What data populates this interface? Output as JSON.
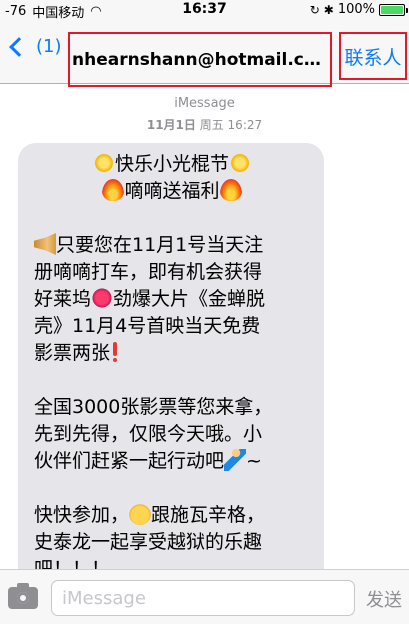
{
  "status_bar": {
    "signal": "-76",
    "carrier": "中国移动",
    "time": "16:37",
    "battery_percent": "100%",
    "battery_level": 1.0
  },
  "nav": {
    "back_label": "(1)",
    "recipient": "nhearnshann@hotmail.com",
    "contact_label": "联系人"
  },
  "conversation": {
    "service": "iMessage",
    "date": "11月1日",
    "weekday_time": "周五 16:27"
  },
  "message": {
    "title_line1": "快乐小光棍节",
    "title_line2": "嘀嘀送福利",
    "p1_l1": "只要您在11月1号当天注",
    "p1_l2": "册嘀嘀打车，即有机会获得",
    "p1_l3": "好莱坞",
    "p1_l3b": "劲爆大片《金蝉脱",
    "p1_l4": "壳》11月4号首映当天免费",
    "p1_l5": "影票两张",
    "p2_l1": "全国3000张影票等您来拿，",
    "p2_l2": "先到先得，仅限今天哦。小",
    "p2_l3": "伙伴们赶紧一起行动吧",
    "p2_l3b": "~",
    "p3_l1": "快快参加，",
    "p3_l1b": "跟施瓦辛格，",
    "p3_l2": "史泰龙一起享受越狱的乐趣",
    "p3_l3": "吧！！！"
  },
  "input_bar": {
    "placeholder": "iMessage",
    "send_label": "发送"
  },
  "colors": {
    "accent": "#0a7aff",
    "highlight_box": "#e3192b",
    "bubble": "#e5e5ea"
  }
}
